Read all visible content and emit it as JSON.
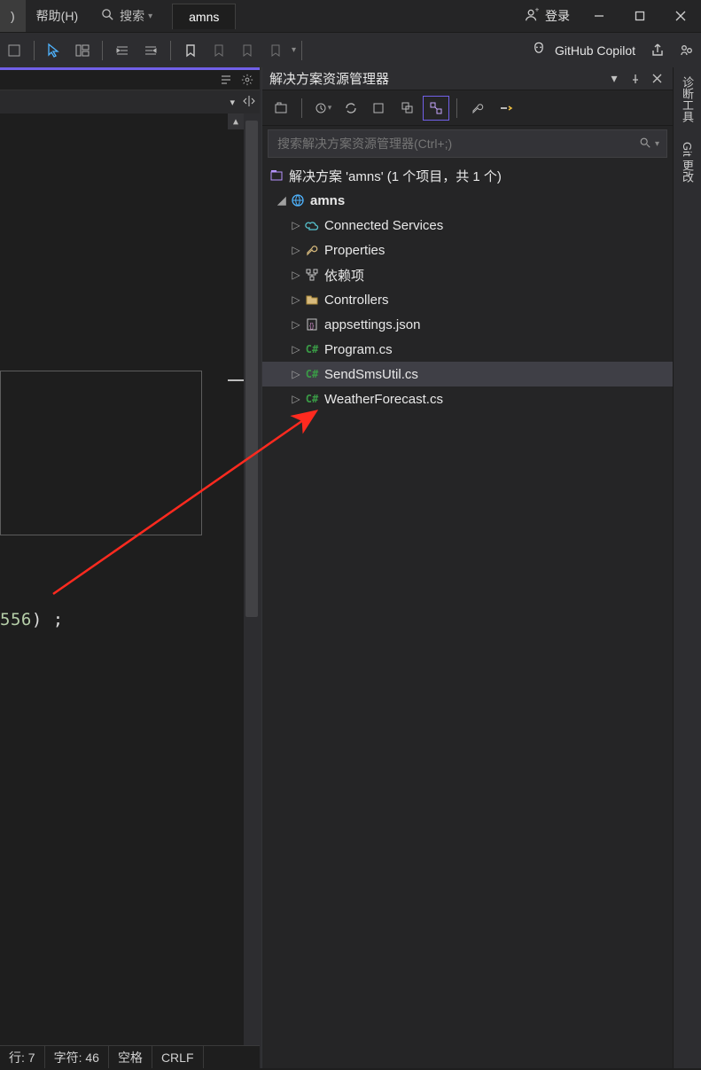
{
  "menu": {
    "window_frag": ")",
    "help": "帮助(H)",
    "search": "搜索"
  },
  "document_tab": "amns",
  "login": "登录",
  "copilot": "GitHub Copilot",
  "editor": {
    "code_number": "556",
    "code_tail": ") ;"
  },
  "statusbar": {
    "line": "行: 7",
    "char": "字符: 46",
    "ins": "空格",
    "eol": "CRLF"
  },
  "right_rail": {
    "diag": "诊断工具",
    "git": "Git 更改"
  },
  "solution_explorer": {
    "title": "解决方案资源管理器",
    "search_placeholder": "搜索解决方案资源管理器(Ctrl+;)",
    "root": "解决方案 'amns' (1 个项目，共 1 个)",
    "project": "amns",
    "items": [
      {
        "label": "Connected Services",
        "icon": "cloud"
      },
      {
        "label": "Properties",
        "icon": "wrench"
      },
      {
        "label": "依赖项",
        "icon": "deps"
      },
      {
        "label": "Controllers",
        "icon": "folder"
      },
      {
        "label": "appsettings.json",
        "icon": "json"
      },
      {
        "label": "Program.cs",
        "icon": "cs"
      },
      {
        "label": "SendSmsUtil.cs",
        "icon": "cs",
        "selected": true
      },
      {
        "label": "WeatherForecast.cs",
        "icon": "cs"
      }
    ]
  }
}
